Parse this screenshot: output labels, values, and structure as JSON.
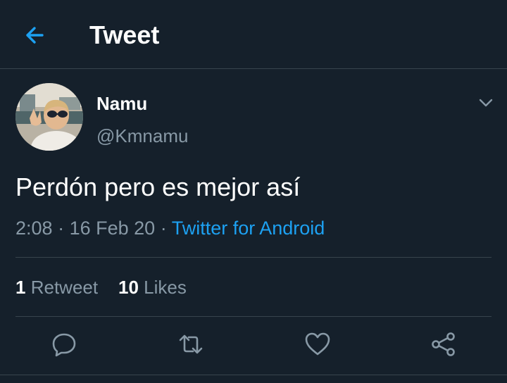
{
  "header": {
    "title": "Tweet",
    "back_icon": "arrow-left-icon"
  },
  "tweet": {
    "display_name": "Namu",
    "handle": "@Kmnamu",
    "text": "Perdón pero es mejor así",
    "time": "2:08",
    "separator": "·",
    "date": "16 Feb 20",
    "source": "Twitter for Android"
  },
  "stats": {
    "retweets_count": "1",
    "retweets_label": "Retweet",
    "likes_count": "10",
    "likes_label": "Likes"
  },
  "actions": {
    "reply_icon": "reply-icon",
    "retweet_icon": "retweet-icon",
    "like_icon": "heart-icon",
    "share_icon": "share-icon"
  },
  "colors": {
    "background": "#15202b",
    "accent": "#1da1f2",
    "secondary_text": "#8899a6",
    "divider": "#38444d"
  }
}
